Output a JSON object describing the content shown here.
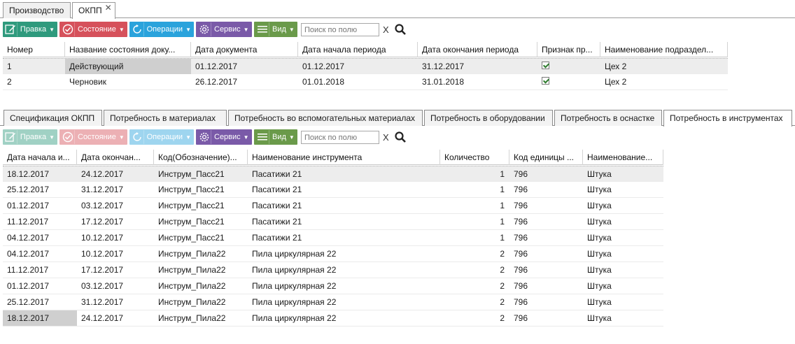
{
  "top_tabs": [
    {
      "label": "Производство"
    },
    {
      "label": "ОКПП"
    }
  ],
  "top_tab_close": "✕",
  "toolbar": {
    "edit_label": "Правка",
    "state_label": "Состояние",
    "ops_label": "Операции",
    "service_label": "Сервис",
    "view_label": "Вид",
    "search_placeholder": "Поиск по полю",
    "clear_label": "X",
    "colors": {
      "edit": "#2f9a7d",
      "state": "#d6515b",
      "ops": "#2aa3dc",
      "service": "#7a5aa8",
      "view": "#6a9a4a"
    }
  },
  "doc_grid": {
    "columns": [
      "Номер",
      "Название состояния доку...",
      "Дата документа",
      "Дата начала периода",
      "Дата окончания периода",
      "Признак пр...",
      "Наименование подраздел..."
    ],
    "rows": [
      {
        "num": "1",
        "state": "Действующий",
        "doc_date": "01.12.2017",
        "start": "01.12.2017",
        "end": "31.12.2017",
        "flag": true,
        "dept": "Цех 2"
      },
      {
        "num": "2",
        "state": "Черновик",
        "doc_date": "26.12.2017",
        "start": "01.01.2018",
        "end": "31.01.2018",
        "flag": true,
        "dept": "Цех 2"
      }
    ]
  },
  "sub_tabs": [
    {
      "label": "Спецификация ОКПП"
    },
    {
      "label": "Потребность в материалах"
    },
    {
      "label": "Потребность во вспомогательных материалах"
    },
    {
      "label": "Потребность в оборудовании"
    },
    {
      "label": "Потребность в оснастке"
    },
    {
      "label": "Потребность в инструментах"
    }
  ],
  "tools_grid": {
    "columns": [
      "Дата начала и...",
      "Дата окончан...",
      "Код(Обозначение)...",
      "Наименование инструмента",
      "Количество",
      "Код единицы ...",
      "Наименование..."
    ],
    "rows": [
      [
        "18.12.2017",
        "24.12.2017",
        "Инструм_Пасс21",
        "Пасатижи 21",
        "1",
        "796",
        "Штука"
      ],
      [
        "25.12.2017",
        "31.12.2017",
        "Инструм_Пасс21",
        "Пасатижи 21",
        "1",
        "796",
        "Штука"
      ],
      [
        "01.12.2017",
        "03.12.2017",
        "Инструм_Пасс21",
        "Пасатижи 21",
        "1",
        "796",
        "Штука"
      ],
      [
        "11.12.2017",
        "17.12.2017",
        "Инструм_Пасс21",
        "Пасатижи 21",
        "1",
        "796",
        "Штука"
      ],
      [
        "04.12.2017",
        "10.12.2017",
        "Инструм_Пасс21",
        "Пасатижи 21",
        "1",
        "796",
        "Штука"
      ],
      [
        "04.12.2017",
        "10.12.2017",
        "Инструм_Пила22",
        "Пила циркулярная 22",
        "2",
        "796",
        "Штука"
      ],
      [
        "11.12.2017",
        "17.12.2017",
        "Инструм_Пила22",
        "Пила циркулярная 22",
        "2",
        "796",
        "Штука"
      ],
      [
        "01.12.2017",
        "03.12.2017",
        "Инструм_Пила22",
        "Пила циркулярная 22",
        "2",
        "796",
        "Штука"
      ],
      [
        "25.12.2017",
        "31.12.2017",
        "Инструм_Пила22",
        "Пила циркулярная 22",
        "2",
        "796",
        "Штука"
      ],
      [
        "18.12.2017",
        "24.12.2017",
        "Инструм_Пила22",
        "Пила циркулярная 22",
        "2",
        "796",
        "Штука"
      ]
    ]
  }
}
